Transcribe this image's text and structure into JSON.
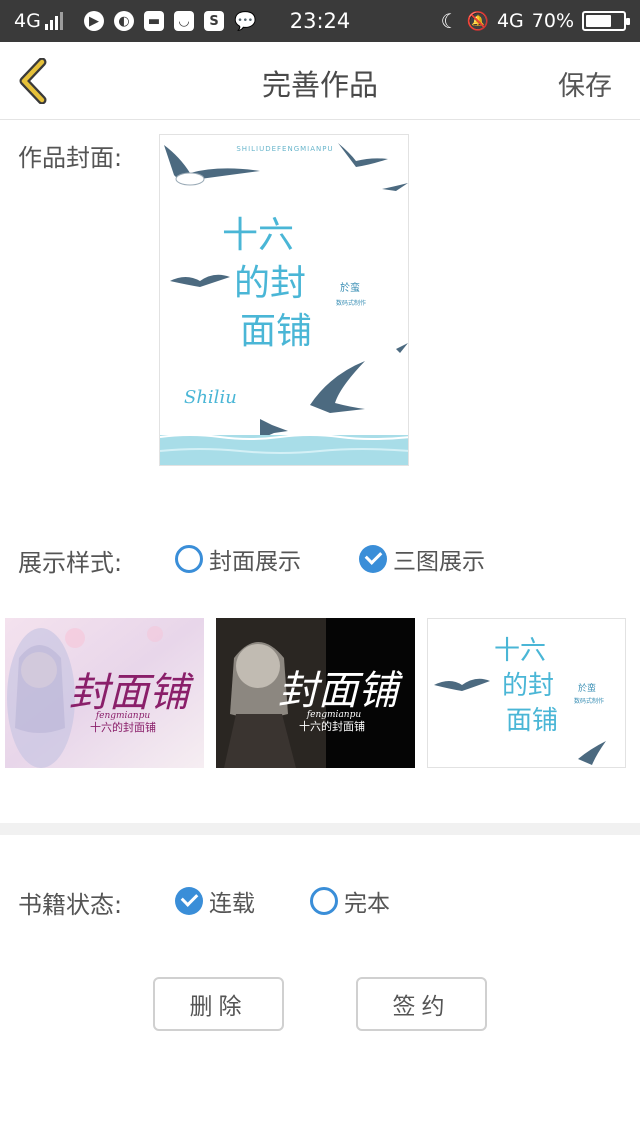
{
  "status_bar": {
    "network_left": "4G",
    "time": "23:24",
    "network_right": "4G",
    "battery": "70%",
    "battery_level": 0.7,
    "icons": [
      "play-icon",
      "browser-icon",
      "image-icon",
      "shopping-bag-icon",
      "s-app-icon",
      "wechat-icon",
      "moon-icon",
      "mute-bell-icon"
    ]
  },
  "nav": {
    "title": "完善作品",
    "save_label": "保存",
    "back_icon": "chevron-left-icon",
    "accent_color": "#d8b21a"
  },
  "cover": {
    "label": "作品封面:",
    "spine_text": "SHILIUDEFENGMIANPU",
    "title_lines": [
      "十六",
      "的封",
      "面铺"
    ],
    "side_text": "於蛮",
    "side_sub": "数码式制作",
    "signature": "Shiliu"
  },
  "display_style": {
    "label": "展示样式:",
    "options": [
      {
        "label": "封面展示",
        "selected": false
      },
      {
        "label": "三图展示",
        "selected": true
      }
    ],
    "thumbnails": [
      {
        "title": "封面铺",
        "pinyin": "fengmianpu",
        "subtitle": "十六的封面铺"
      },
      {
        "title": "封面铺",
        "pinyin": "fengmianpu",
        "subtitle": "十六的封面铺"
      },
      {
        "title_lines": [
          "十六",
          "的封",
          "面铺"
        ],
        "side_text": "於蛮",
        "side_sub": "数码式制作"
      }
    ]
  },
  "book_status": {
    "label": "书籍状态:",
    "options": [
      {
        "label": "连载",
        "selected": true
      },
      {
        "label": "完本",
        "selected": false
      }
    ]
  },
  "actions": {
    "delete_label": "删除",
    "sign_label": "签约"
  },
  "colors": {
    "radio_blue": "#3a8ed8",
    "status_bar_bg": "#3a3a3a",
    "cover_text": "#4ab6d6",
    "sea": "#a8dde8"
  }
}
